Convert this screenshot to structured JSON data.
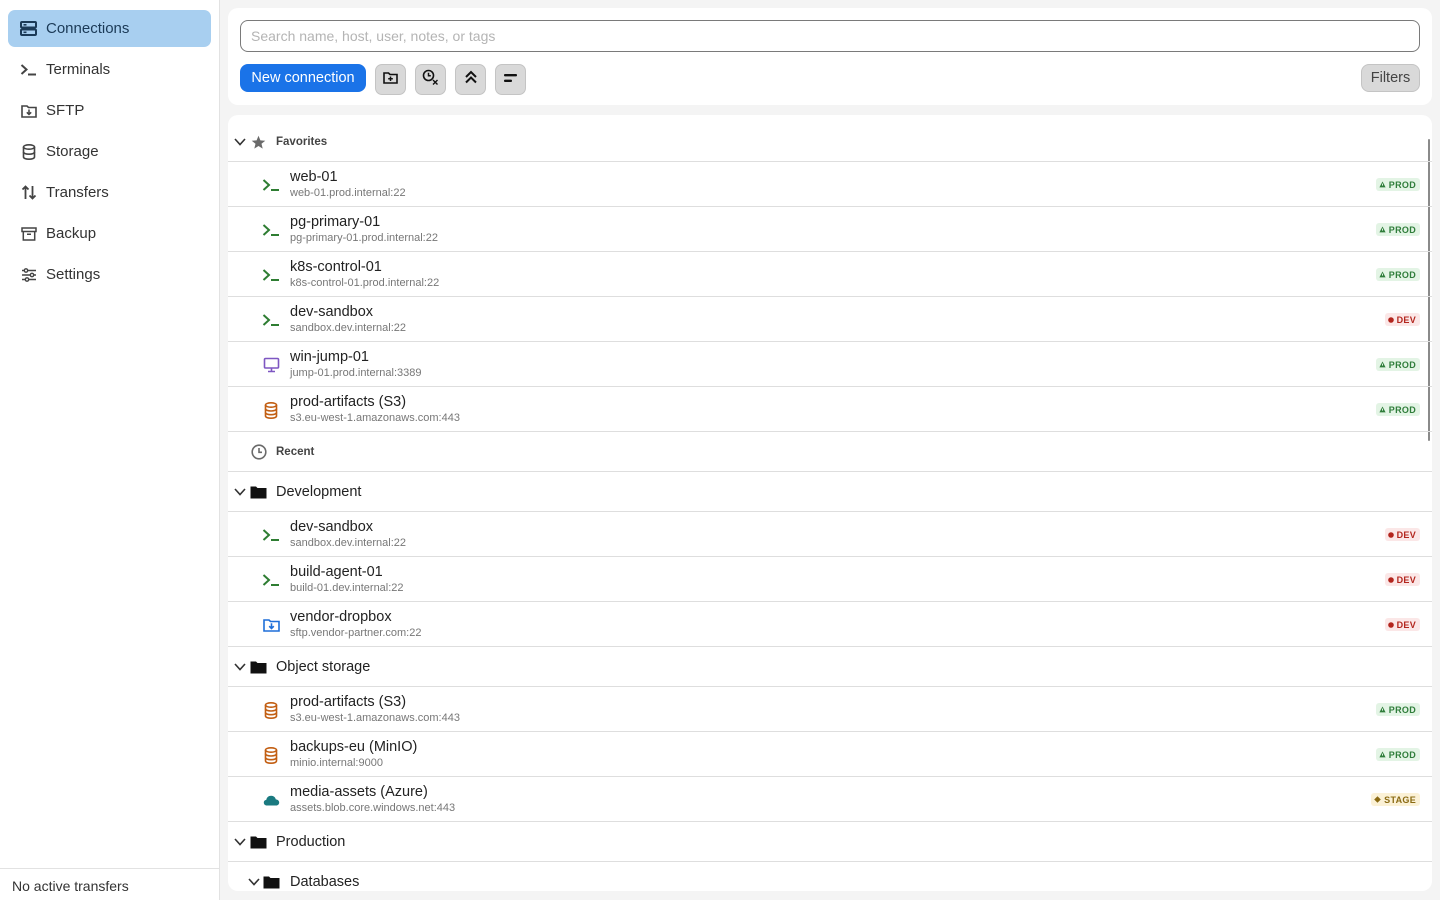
{
  "sidebar": {
    "items": [
      {
        "label": "Connections",
        "icon": "connections-icon",
        "active": true
      },
      {
        "label": "Terminals",
        "icon": "terminal-icon"
      },
      {
        "label": "SFTP",
        "icon": "sftp-folder-icon"
      },
      {
        "label": "Storage",
        "icon": "database-icon"
      },
      {
        "label": "Transfers",
        "icon": "transfer-arrows-icon"
      },
      {
        "label": "Backup",
        "icon": "archive-icon"
      },
      {
        "label": "Settings",
        "icon": "sliders-icon"
      }
    ],
    "status": "No active transfers"
  },
  "toolbar": {
    "search_placeholder": "Search name, host, user, notes, or tags",
    "new_connection_label": "New connection",
    "filters_label": "Filters"
  },
  "list": {
    "favorites": {
      "title": "Favorites",
      "items": [
        {
          "name": "web-01",
          "host": "web-01.prod.internal:22",
          "type": "ssh",
          "env": "PROD"
        },
        {
          "name": "pg-primary-01",
          "host": "pg-primary-01.prod.internal:22",
          "type": "ssh",
          "env": "PROD"
        },
        {
          "name": "k8s-control-01",
          "host": "k8s-control-01.prod.internal:22",
          "type": "ssh",
          "env": "PROD"
        },
        {
          "name": "dev-sandbox",
          "host": "sandbox.dev.internal:22",
          "type": "ssh",
          "env": "DEV"
        },
        {
          "name": "win-jump-01",
          "host": "jump-01.prod.internal:3389",
          "type": "rdp",
          "env": "PROD"
        },
        {
          "name": "prod-artifacts (S3)",
          "host": "s3.eu-west-1.amazonaws.com:443",
          "type": "s3",
          "env": "PROD"
        }
      ]
    },
    "recent": {
      "title": "Recent"
    },
    "development": {
      "title": "Development",
      "items": [
        {
          "name": "dev-sandbox",
          "host": "sandbox.dev.internal:22",
          "type": "ssh",
          "env": "DEV"
        },
        {
          "name": "build-agent-01",
          "host": "build-01.dev.internal:22",
          "type": "ssh",
          "env": "DEV"
        },
        {
          "name": "vendor-dropbox",
          "host": "sftp.vendor-partner.com:22",
          "type": "sftp",
          "env": "DEV"
        }
      ]
    },
    "object_storage": {
      "title": "Object storage",
      "items": [
        {
          "name": "prod-artifacts (S3)",
          "host": "s3.eu-west-1.amazonaws.com:443",
          "type": "s3",
          "env": "PROD"
        },
        {
          "name": "backups-eu (MinIO)",
          "host": "minio.internal:9000",
          "type": "s3",
          "env": "PROD"
        },
        {
          "name": "media-assets (Azure)",
          "host": "assets.blob.core.windows.net:443",
          "type": "azure",
          "env": "STAGE"
        }
      ]
    },
    "production": {
      "title": "Production",
      "subfolder": "Databases"
    }
  },
  "colors": {
    "accent": "#1a73e8",
    "nav_active": "#a8cff0",
    "ssh": "#2e7d32",
    "rdp": "#7e57c2",
    "s3": "#c25e12",
    "sftp": "#1e6fd9",
    "azure": "#1a7a80"
  }
}
